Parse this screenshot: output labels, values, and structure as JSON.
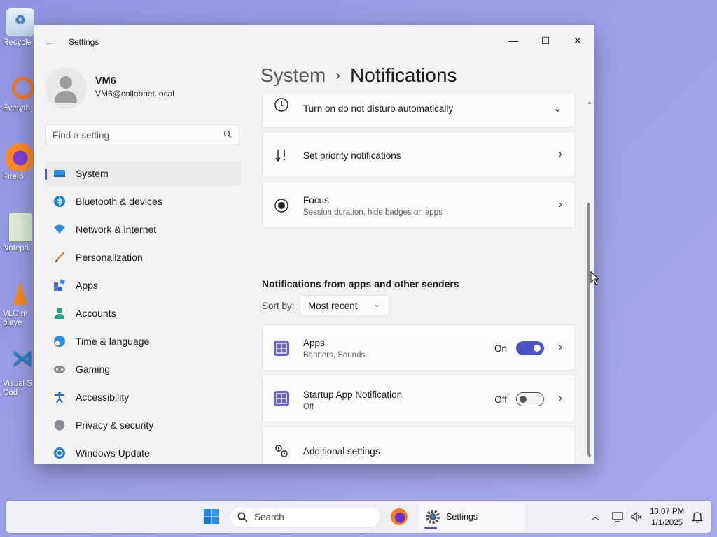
{
  "desktop": {
    "icons": [
      {
        "label": "Recycle"
      },
      {
        "label": "Everyth"
      },
      {
        "label": "Firefo"
      },
      {
        "label": "Notepa"
      },
      {
        "label": "VLC m\nplaye"
      },
      {
        "label": "Visual S\nCod"
      }
    ]
  },
  "window": {
    "title": "Settings",
    "controls": {
      "minimize": "—",
      "maximize": "☐",
      "close": "✕"
    }
  },
  "profile": {
    "name": "VM6",
    "email": "VM6@collabnet.local"
  },
  "search": {
    "placeholder": "Find a setting"
  },
  "sidebar": {
    "items": [
      {
        "label": "System",
        "icon": "monitor-icon"
      },
      {
        "label": "Bluetooth & devices",
        "icon": "bluetooth-icon"
      },
      {
        "label": "Network & internet",
        "icon": "wifi-icon"
      },
      {
        "label": "Personalization",
        "icon": "brush-icon"
      },
      {
        "label": "Apps",
        "icon": "apps-icon"
      },
      {
        "label": "Accounts",
        "icon": "person-icon"
      },
      {
        "label": "Time & language",
        "icon": "globe-clock-icon"
      },
      {
        "label": "Gaming",
        "icon": "gamepad-icon"
      },
      {
        "label": "Accessibility",
        "icon": "accessibility-icon"
      },
      {
        "label": "Privacy & security",
        "icon": "shield-icon"
      },
      {
        "label": "Windows Update",
        "icon": "update-icon"
      }
    ]
  },
  "breadcrumb": {
    "parent": "System",
    "separator": "›",
    "current": "Notifications"
  },
  "settings": {
    "dnd_auto": {
      "title": "Turn on do not disturb automatically"
    },
    "priority": {
      "title": "Set priority notifications"
    },
    "focus": {
      "title": "Focus",
      "subtitle": "Session duration, hide badges on apps"
    }
  },
  "senders": {
    "section_title": "Notifications from apps and other senders",
    "sort_label": "Sort by:",
    "sort_value": "Most recent",
    "apps": [
      {
        "title": "Apps",
        "subtitle": "Banners, Sounds",
        "state": "On"
      },
      {
        "title": "Startup App Notification",
        "subtitle": "Off",
        "state": "Off"
      }
    ],
    "additional": {
      "title": "Additional settings"
    }
  },
  "taskbar": {
    "search_placeholder": "Search",
    "active_app": "Settings",
    "time": "10:07 PM",
    "date": "1/1/2025"
  },
  "colors": {
    "accent": "#4a52c6",
    "desktop": "#9a9de4"
  }
}
